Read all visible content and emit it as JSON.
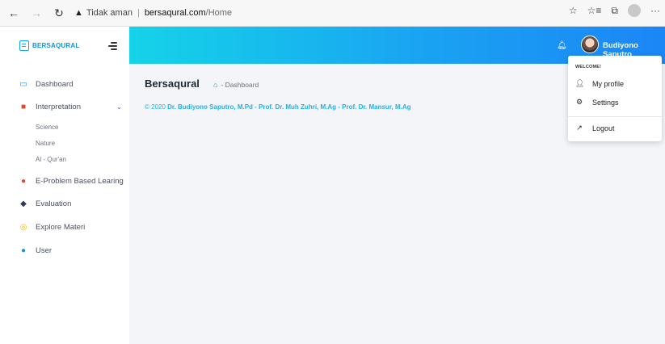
{
  "browser": {
    "back_icon": "arrow-left-icon",
    "forward_icon": "arrow-right-icon",
    "reload_icon": "refresh-icon",
    "warning_icon": "warning-triangle-icon",
    "security_text": "Tidak aman",
    "separator": "|",
    "host": "bersaqural.com",
    "path": "/Home",
    "more": "···"
  },
  "brand": {
    "name": "BERSAQURAL",
    "accent": "#11a5f1"
  },
  "sidebar": {
    "items": [
      {
        "label": "Dashboard",
        "icon": "dashboard-icon"
      },
      {
        "label": "Interpretation",
        "icon": "book-icon"
      },
      {
        "label": "E-Problem Based Learing",
        "icon": "problem-icon"
      },
      {
        "label": "Evaluation",
        "icon": "graduation-cap-icon"
      },
      {
        "label": "Explore Materi",
        "icon": "compass-icon"
      },
      {
        "label": "User",
        "icon": "user-circle-icon"
      }
    ],
    "subitems": [
      "Science",
      "Nature",
      "Al - Qur'an"
    ]
  },
  "topbar": {
    "user_name": "Budiyono Saputro",
    "gradient_start": "#15d3e8",
    "gradient_end": "#1b86f6"
  },
  "main": {
    "title": "Bersaqural",
    "breadcrumb_current": "- Dashboard",
    "copyright_prefix": "© 2020",
    "copyright_names": "Dr. Budiyono Saputro, M.Pd - Prof. Dr. Muh Zuhri, M.Ag - Prof. Dr. Mansur, M.Ag"
  },
  "dropdown": {
    "header": "WELCOME!",
    "items": [
      {
        "label": "My profile",
        "icon": "user-icon"
      },
      {
        "label": "Settings",
        "icon": "gear-icon"
      },
      {
        "label": "Logout",
        "icon": "logout-icon"
      }
    ]
  }
}
